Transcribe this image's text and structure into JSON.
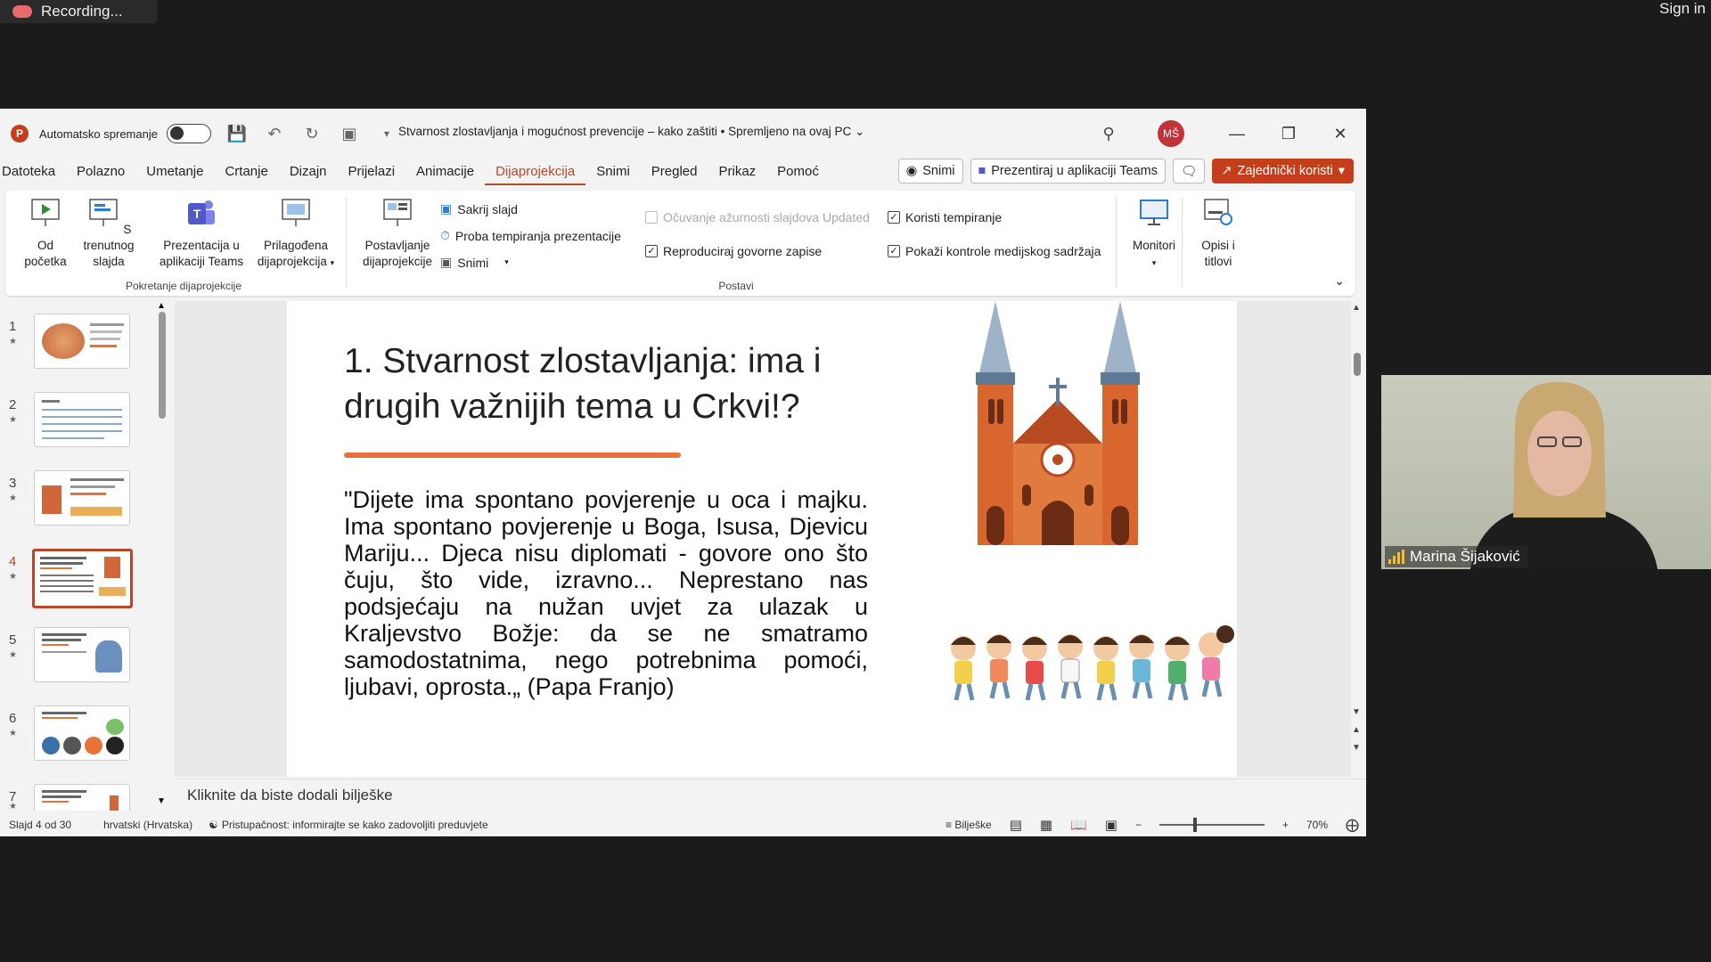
{
  "recording": {
    "label": "Recording..."
  },
  "signin": {
    "label": "Sign in"
  },
  "titlebar": {
    "autosave_label": "Automatsko spremanje",
    "document_title": "Stvarnost zlostavljanja i mogućnost prevencije – kako zaštiti • Spremljeno na ovaj PC",
    "avatar_initials": "MŠ"
  },
  "menu": {
    "items": [
      "Datoteka",
      "Polazno",
      "Umetanje",
      "Crtanje",
      "Dizajn",
      "Prijelazi",
      "Animacije",
      "Dijaprojekcija",
      "Snimi",
      "Pregled",
      "Prikaz",
      "Pomoć"
    ],
    "active": "Dijaprojekcija",
    "record_label": "Snimi",
    "teams_label": "Prezentiraj u aplikaciji Teams",
    "share_label": "Zajednički koristi"
  },
  "ribbon": {
    "from_start": "Od početka",
    "from_current": "S trenutnog slajda",
    "teams_present": "Prezentacija u aplikaciji Teams",
    "custom_show": "Prilagođena dijaprojekcija",
    "group1_label": "Pokretanje dijaprojekcije",
    "setup_show": "Postavljanje dijaprojekcije",
    "hide_slide": "Sakrij slajd",
    "rehearse": "Proba tempiranja prezentacije",
    "record": "Snimi",
    "keep_updated": "Očuvanje ažurnosti slajdova Updated",
    "play_narrations": "Reproduciraj govorne zapise",
    "use_timings": "Koristi tempiranje",
    "show_media_controls": "Pokaži kontrole medijskog sadržaja",
    "group2_label": "Postavi",
    "monitors": "Monitori",
    "captions": "Opisi i titlovi"
  },
  "thumbnails": {
    "numbers": [
      "1",
      "2",
      "3",
      "4",
      "5",
      "6",
      "7"
    ],
    "active_index": 3
  },
  "slide": {
    "title": "1. Stvarnost zlostavljanja: ima i drugih važnijih tema u Crkvi!?",
    "quote": "\"Dijete ima spontano povjerenje u oca i majku. Ima spontano povjerenje u Boga, Isusa, Djevicu Mariju... Djeca nisu diplomati - govore ono što čuju, što vide, izravno... Neprestano nas podsjećaju na nužan uvjet za ulazak u Kraljevstvo Božje: da se ne smatramo samodostatnima, nego potrebnima pomoći, ljubavi, oprosta.„ (Papa Franjo)"
  },
  "notes": {
    "placeholder": "Kliknite da biste dodali bilješke"
  },
  "status": {
    "slide_count": "Slajd 4 od 30",
    "language": "hrvatski (Hrvatska)",
    "accessibility": "Pristupačnost: informirajte se kako zadovoljiti preduvjete",
    "notes_label": "Bilješke",
    "zoom": "70%"
  },
  "video": {
    "participant_name": "Marina Šijaković"
  },
  "colors": {
    "accent": "#b7472a",
    "share_button": "#c43e1c",
    "underline": "#e8733a"
  }
}
